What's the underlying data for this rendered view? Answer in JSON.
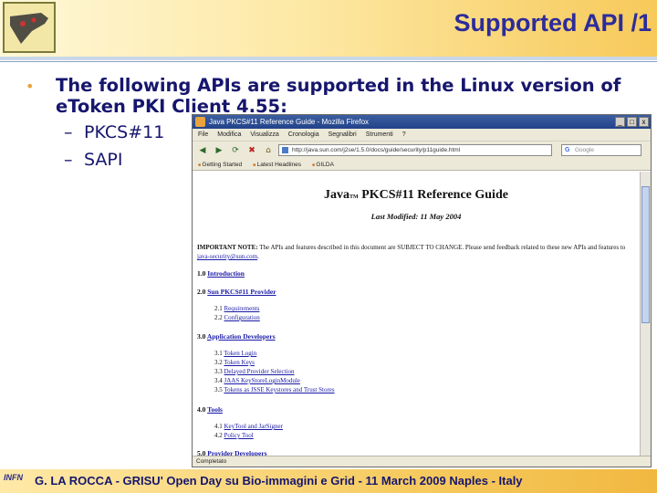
{
  "slide": {
    "title": "Supported API /1",
    "bullet": "The following APIs are supported in the Linux version of eToken PKI Client 4.55:",
    "sub_items": [
      "PKCS#11",
      "SAPI"
    ],
    "sub_dash": "–",
    "footer_logo_text": "INFN",
    "footer": "G. LA ROCCA - GRISU' Open Day su Bio-immagini e Grid - 11 March 2009 Naples - Italy"
  },
  "browser": {
    "window_title": "Java PKCS#11 Reference Guide - Mozilla Firefox",
    "window_buttons": [
      "_",
      "□",
      "x"
    ],
    "menu": [
      "File",
      "Modifica",
      "Visualizza",
      "Cronologia",
      "Segnalibri",
      "Strumenti",
      "?"
    ],
    "nav_icons": [
      "back-icon",
      "forward-icon",
      "reload-icon",
      "stop-icon",
      "home-icon"
    ],
    "nav_glyphs": [
      "◀",
      "▶",
      "⟳",
      "✖",
      "⌂"
    ],
    "url": "http://java.sun.com/j2se/1.5.0/docs/guide/security/p11guide.html",
    "search_placeholder": "Google",
    "bookmarks": [
      "Getting Started",
      "Latest Headlines",
      "GILDA"
    ],
    "status": "Completato"
  },
  "document": {
    "title_main": "Java",
    "title_tm": "TM",
    "title_rest": " PKCS#11 Reference Guide",
    "last_modified": "Last Modified: 11 May 2004",
    "note_prefix": "IMPORTANT NOTE:",
    "note_text": " The APIs and features described in this document are SUBJECT TO CHANGE. Please send feedback related to these new APIs and features to ",
    "note_email": "java-security@sun.com",
    "note_end": ".",
    "sections": [
      {
        "num": "1.0",
        "title": "Introduction"
      },
      {
        "num": "2.0",
        "title": "Sun PKCS#11 Provider"
      },
      {
        "num": "3.0",
        "title": "Application Developers"
      },
      {
        "num": "4.0",
        "title": "Tools"
      },
      {
        "num": "5.0",
        "title": "Provider Developers"
      }
    ],
    "subsections_2": [
      {
        "num": "2.1",
        "title": "Requirements"
      },
      {
        "num": "2.2",
        "title": "Configuration"
      }
    ],
    "subsections_3": [
      {
        "num": "3.1",
        "title": "Token Login"
      },
      {
        "num": "3.2",
        "title": "Token Keys"
      },
      {
        "num": "3.3",
        "title": "Delayed Provider Selection"
      },
      {
        "num": "3.4",
        "title": "JAAS KeyStoreLoginModule"
      },
      {
        "num": "3.5",
        "title": "Tokens as JSSE Keystores and Trust Stores"
      }
    ],
    "subsections_4": [
      {
        "num": "4.1",
        "title": "KeyTool and JarSigner"
      },
      {
        "num": "4.2",
        "title": "Policy Tool"
      }
    ]
  },
  "colors": {
    "title": "#2c2c9a",
    "body_text": "#16166e",
    "bullet": "#e6a23c",
    "link": "#1a1aa6"
  }
}
